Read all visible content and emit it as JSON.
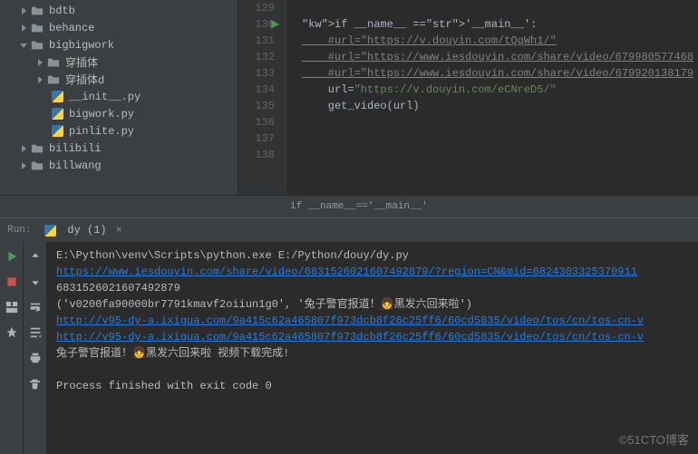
{
  "sidebar": {
    "items": [
      {
        "label": "bdtb",
        "indent": 1,
        "expanded": false,
        "icon": "folder"
      },
      {
        "label": "behance",
        "indent": 1,
        "expanded": false,
        "icon": "folder"
      },
      {
        "label": "bigbigwork",
        "indent": 1,
        "expanded": true,
        "icon": "folder"
      },
      {
        "label": "穿插体",
        "indent": 2,
        "expanded": false,
        "icon": "folder"
      },
      {
        "label": "穿插体d",
        "indent": 2,
        "expanded": false,
        "icon": "folder"
      },
      {
        "label": "__init__.py",
        "indent": 3,
        "icon": "py"
      },
      {
        "label": "bigwork.py",
        "indent": 3,
        "icon": "py"
      },
      {
        "label": "pinlite.py",
        "indent": 3,
        "icon": "py"
      },
      {
        "label": "bilibili",
        "indent": 1,
        "expanded": false,
        "icon": "folder"
      },
      {
        "label": "billwang",
        "indent": 1,
        "expanded": false,
        "icon": "folder"
      }
    ]
  },
  "editor": {
    "lines": [
      {
        "n": "129",
        "raw": ""
      },
      {
        "n": "130",
        "raw": "if __name__ =='__main__':",
        "runmark": true
      },
      {
        "n": "131",
        "raw": "    #url=\"https://v.douyin.com/tQqWh1/\"",
        "cmt": true
      },
      {
        "n": "132",
        "raw": "    #url=\"https://www.iesdouyin.com/share/video/679980577468",
        "cmt": true
      },
      {
        "n": "133",
        "raw": "    #url=\"https://www.iesdouyin.com/share/video/679920138179",
        "cmt": true
      },
      {
        "n": "134",
        "raw": "    url=\"https://v.douyin.com/eCNreD5/\""
      },
      {
        "n": "135",
        "raw": "    get_video(url)"
      },
      {
        "n": "136",
        "raw": ""
      },
      {
        "n": "137",
        "raw": ""
      },
      {
        "n": "138",
        "raw": ""
      }
    ]
  },
  "breadcrumb": "if __name__=='__main__'",
  "run": {
    "label": "Run:",
    "tab": "dy (1)",
    "output": [
      {
        "t": "E:\\Python\\venv\\Scripts\\python.exe  E:/Python/douy/dy.py"
      },
      {
        "t": "https://www.iesdouyin.com/share/video/6831526021607492879/?region=CN&mid=6824303325370911",
        "link": true
      },
      {
        "t": "6831526021607492879"
      },
      {
        "t": "('v0200fa90000br7791kmavf2oiiun1g0', '兔子警官报道！👧黑发六回来啦')"
      },
      {
        "t": "http://v95-dy-a.ixigua.com/9a415c62a465807f973dcb8f26c25ff6/60cd5835/video/tos/cn/tos-cn-v",
        "link": true
      },
      {
        "t": "http://v95-dy-a.ixigua.com/9a415c62a465807f973dcb8f26c25ff6/60cd5835/video/tos/cn/tos-cn-v",
        "link": true
      },
      {
        "t": "兔子警官报道！👧黑发六回来啦  视频下载完成!"
      },
      {
        "t": ""
      },
      {
        "t": "Process finished with exit code 0"
      }
    ]
  },
  "watermark": "©51CTO博客"
}
